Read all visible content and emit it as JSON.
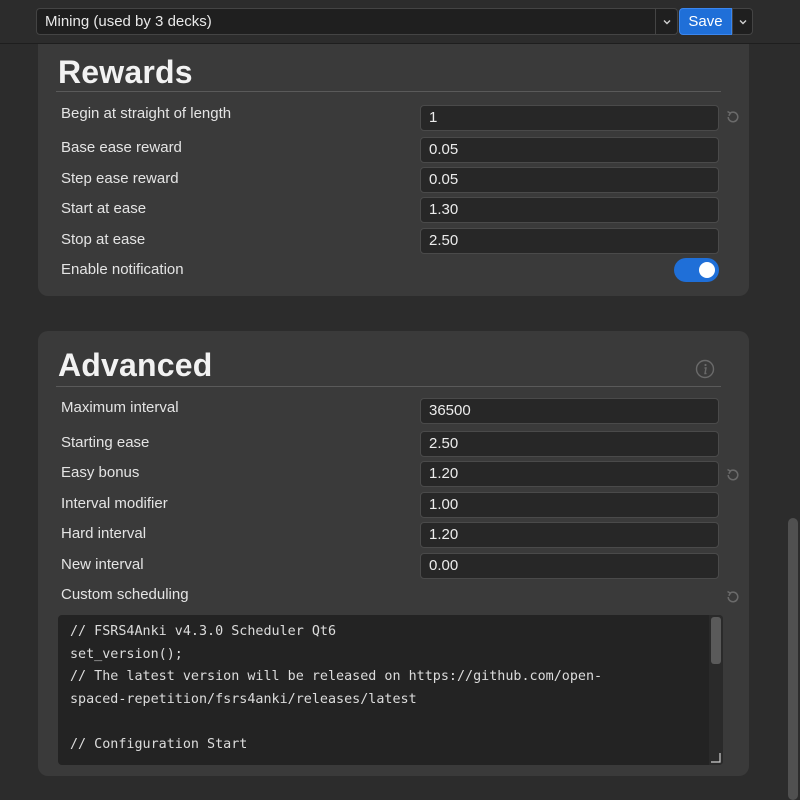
{
  "topbar": {
    "preset": "Mining (used by 3 decks)",
    "save_label": "Save"
  },
  "rewards": {
    "title": "Rewards",
    "rows": [
      {
        "label": "Begin at straight of length",
        "value": "1",
        "reset": true
      },
      {
        "label": "Base ease reward",
        "value": "0.05"
      },
      {
        "label": "Step ease reward",
        "value": "0.05"
      },
      {
        "label": "Start at ease",
        "value": "1.30"
      },
      {
        "label": "Stop at ease",
        "value": "2.50"
      }
    ],
    "notification": {
      "label": "Enable notification",
      "enabled": true
    }
  },
  "advanced": {
    "title": "Advanced",
    "rows": [
      {
        "label": "Maximum interval",
        "value": "36500"
      },
      {
        "label": "Starting ease",
        "value": "2.50"
      },
      {
        "label": "Easy bonus",
        "value": "1.20",
        "reset": true
      },
      {
        "label": "Interval modifier",
        "value": "1.00"
      },
      {
        "label": "Hard interval",
        "value": "1.20"
      },
      {
        "label": "New interval",
        "value": "0.00"
      }
    ],
    "custom_scheduling_label": "Custom scheduling",
    "code_lines": [
      "// FSRS4Anki v4.3.0 Scheduler Qt6",
      "set_version();",
      "// The latest version will be released on https://github.com/open-",
      "spaced-repetition/fsrs4anki/releases/latest",
      "",
      "// Configuration Start"
    ]
  },
  "colors": {
    "accent": "#1f6fd8",
    "background": "#2c2c2c",
    "card": "#3a3a3a",
    "field": "#272727"
  },
  "icons": {
    "preset_chevron": "chevron-down-icon",
    "save_chevron": "chevron-down-icon",
    "reset": "reset-icon",
    "info": "info-icon"
  }
}
